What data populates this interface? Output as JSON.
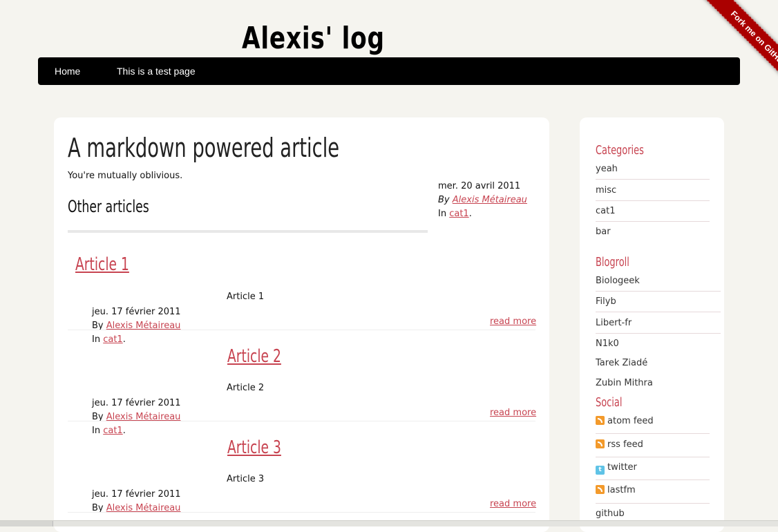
{
  "site": {
    "title": "Alexis' log"
  },
  "menu": [
    {
      "label": "Home"
    },
    {
      "label": "This is a test page"
    }
  ],
  "ribbon": {
    "label": "Fork me on GitHub"
  },
  "article": {
    "title": "A markdown powered article",
    "summary": "You're mutually oblivious.",
    "date": "mer. 20 avril 2011",
    "by_label": "By",
    "author": "Alexis Métaireau",
    "in_label": "In",
    "category": "cat1",
    "period": "."
  },
  "other_heading": "Other articles",
  "other_articles": [
    {
      "title": "Article 1",
      "summary": "Article 1",
      "date": "jeu. 17 février 2011",
      "by_label": "By",
      "author": "Alexis Métaireau",
      "in_label": "In",
      "category": "cat1",
      "period": ".",
      "read_more": "read more"
    },
    {
      "title": "Article 2",
      "summary": "Article 2",
      "date": "jeu. 17 février 2011",
      "by_label": "By",
      "author": "Alexis Métaireau",
      "in_label": "In",
      "category": "cat1",
      "period": ".",
      "read_more": "read more"
    },
    {
      "title": "Article 3",
      "summary": "Article 3",
      "date": "jeu. 17 février 2011",
      "by_label": "By",
      "author": "Alexis Métaireau",
      "read_more": "read more"
    }
  ],
  "sidebar": {
    "categories_heading": "Categories",
    "categories": [
      "yeah",
      "misc",
      "cat1",
      "bar"
    ],
    "blogroll_heading": "Blogroll",
    "blogroll": [
      "Biologeek",
      "Filyb",
      "Libert-fr",
      "N1k0",
      "Tarek Ziadé",
      "Zubin Mithra"
    ],
    "social_heading": "Social",
    "social": [
      {
        "label": "atom feed",
        "icon": "rss-icon"
      },
      {
        "label": "rss feed",
        "icon": "rss-icon"
      },
      {
        "label": "twitter",
        "icon": "twitter-icon"
      },
      {
        "label": "lastfm",
        "icon": "rss-icon"
      },
      {
        "label": "github",
        "icon": ""
      }
    ]
  },
  "colors": {
    "accent": "#c74350",
    "menu_bg": "#000000",
    "page_bg": "#f5f4ef",
    "ribbon": "#aa0000"
  }
}
